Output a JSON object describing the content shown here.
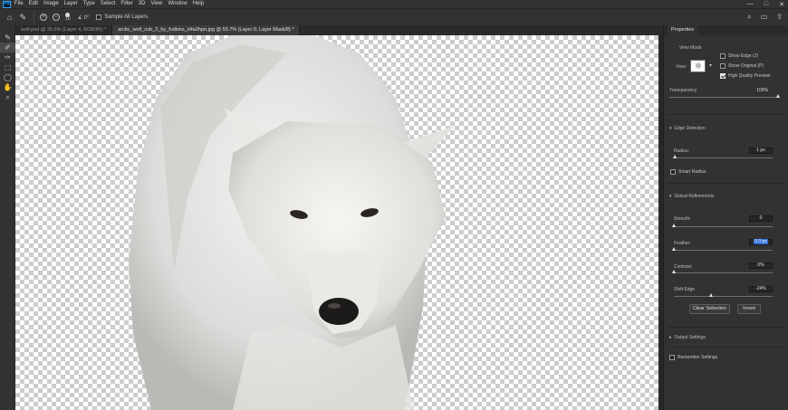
{
  "app": {
    "logo": "Ps",
    "menu": [
      "File",
      "Edit",
      "Image",
      "Layer",
      "Type",
      "Select",
      "Filter",
      "3D",
      "View",
      "Window",
      "Help"
    ],
    "window_controls": [
      "—",
      "□",
      "✕"
    ]
  },
  "options_bar": {
    "brush_size": "10",
    "angle_value": "0°",
    "sample_all_layers_label": "Sample All Layers",
    "sample_all_layers_checked": false
  },
  "tabs": [
    {
      "label": "wolf.psd @ 25.6% (Layer 4, RGB/8#) *",
      "active": false
    },
    {
      "label": "arctic_wolf_cub_2_by_fudkins_d4a2hpo.jpg @ 53.7% (Layer 0, Layer Mask/8) *",
      "active": true
    }
  ],
  "tools": [
    "brush",
    "quick-selection",
    "refine-edge-brush",
    "object-selection",
    "lasso",
    "hand",
    "zoom"
  ],
  "properties": {
    "tab_label": "Properties",
    "view_mode_label": "View Mode",
    "view_label": "View:",
    "show_edge_label": "Show Edge (J)",
    "show_original_label": "Show Original (P)",
    "high_quality_label": "High Quality Preview",
    "show_edge_checked": false,
    "show_original_checked": false,
    "high_quality_checked": true,
    "transparency_label": "Transparency",
    "transparency_value": "100%",
    "transparency_level": 1.0,
    "edge_detection_label": "Edge Detection",
    "radius_label": "Radius:",
    "radius_value": "1 px",
    "radius_level": 0.01,
    "smart_radius_label": "Smart Radius",
    "global_refinements_label": "Global Refinements",
    "smooth_label": "Smooth:",
    "smooth_value": "0",
    "smooth_level": 0.0,
    "feather_label": "Feather:",
    "feather_value": "0.0 px",
    "feather_level": 0.0,
    "contrast_label": "Contrast:",
    "contrast_value": "0%",
    "contrast_level": 0.0,
    "shift_edge_label": "Shift Edge",
    "shift_edge_value": "-24%",
    "shift_edge_level": 0.38,
    "clear_selection_label": "Clear Selection",
    "invert_label": "Invert",
    "output_settings_label": "Output Settings",
    "remember_settings_label": "Remember Settings"
  },
  "colors": {
    "ui_dark": "#323232",
    "ui_darker": "#1e1e1e",
    "accent_selection": "#2f6fd6"
  }
}
